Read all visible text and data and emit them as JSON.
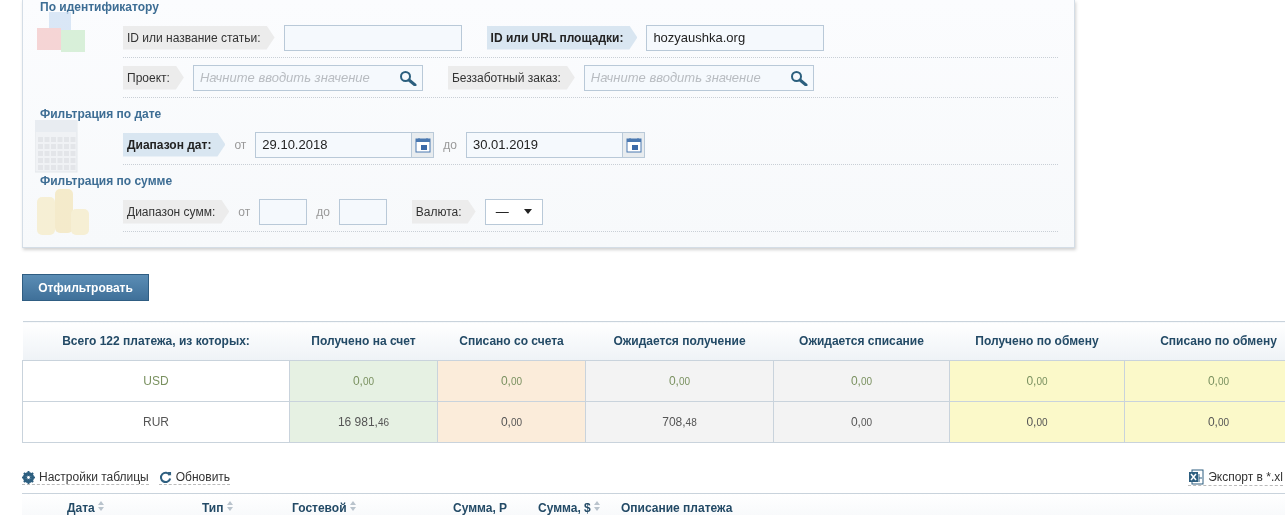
{
  "filter_panel": {
    "sections": [
      {
        "title": "По идентификатору",
        "rows": [
          [
            {
              "kind": "input",
              "label": "ID или название статьи:",
              "highlighted": false
            },
            {
              "kind": "input",
              "label": "ID или URL площадки:",
              "highlighted": true,
              "value": "hozyaushka.org"
            }
          ],
          [
            {
              "kind": "search",
              "label": "Проект:",
              "highlighted": false,
              "placeholder": "Начните вводить значение"
            },
            {
              "kind": "search",
              "label": "Беззаботный заказ:",
              "highlighted": false,
              "placeholder": "Начните вводить значение"
            }
          ]
        ]
      },
      {
        "title": "Фильтрация по дате",
        "rows": [
          [
            {
              "kind": "date_range",
              "label": "Диапазон дат:",
              "highlighted": true,
              "from_label": "от",
              "from": "29.10.2018",
              "to_label": "до",
              "to": "30.01.2019"
            }
          ]
        ]
      },
      {
        "title": "Фильтрация по сумме",
        "rows": [
          [
            {
              "kind": "amount_range",
              "label": "Диапазон сумм:",
              "highlighted": false,
              "from_label": "от",
              "to_label": "до"
            },
            {
              "kind": "select",
              "label": "Валюта:",
              "highlighted": false,
              "value": "—"
            }
          ]
        ]
      }
    ]
  },
  "filter_button": "Отфильтровать",
  "summary": {
    "columns": [
      {
        "label": "Всего 122 платежа, из которых:"
      },
      {
        "label": "Получено на счет",
        "color": "#e6f1e3"
      },
      {
        "label": "Списано со счета",
        "color": "#fbecda"
      },
      {
        "label": "Ожидается получение",
        "color": "#f3f3f3"
      },
      {
        "label": "Ожидается списание",
        "color": "#f3f3f3"
      },
      {
        "label": "Получено по обмену",
        "color": "#fbf9c9"
      },
      {
        "label": "Списано по обмену",
        "color": "#fbf9c9"
      }
    ],
    "rows": [
      {
        "currency": "USD",
        "color": "#7a9160",
        "values": [
          {
            "whole": "0,",
            "fraction": "00"
          },
          {
            "whole": "0,",
            "fraction": "00"
          },
          {
            "whole": "0,",
            "fraction": "00"
          },
          {
            "whole": "0,",
            "fraction": "00"
          },
          {
            "whole": "0,",
            "fraction": "00"
          },
          {
            "whole": "0,",
            "fraction": "00"
          }
        ]
      },
      {
        "currency": "RUR",
        "color": "#555555",
        "values": [
          {
            "whole": "16 981,",
            "fraction": "46"
          },
          {
            "whole": "0,",
            "fraction": "00"
          },
          {
            "whole": "708,",
            "fraction": "48"
          },
          {
            "whole": "0,",
            "fraction": "00"
          },
          {
            "whole": "0,",
            "fraction": "00"
          },
          {
            "whole": "0,",
            "fraction": "00"
          }
        ]
      }
    ]
  },
  "toolbar": {
    "settings": "Настройки таблицы",
    "refresh": "Обновить",
    "export": "Экспорт в *.xl"
  },
  "payments_table": {
    "columns": [
      {
        "label": "Дата",
        "sortable": true
      },
      {
        "label": "Тип",
        "sortable": true
      },
      {
        "label": "Гостевой",
        "sortable": true
      },
      {
        "label": "Сумма, Р",
        "sortable": false
      },
      {
        "label": "Сумма, $",
        "sortable": true
      },
      {
        "label": "Описание платежа",
        "sortable": false
      }
    ]
  }
}
